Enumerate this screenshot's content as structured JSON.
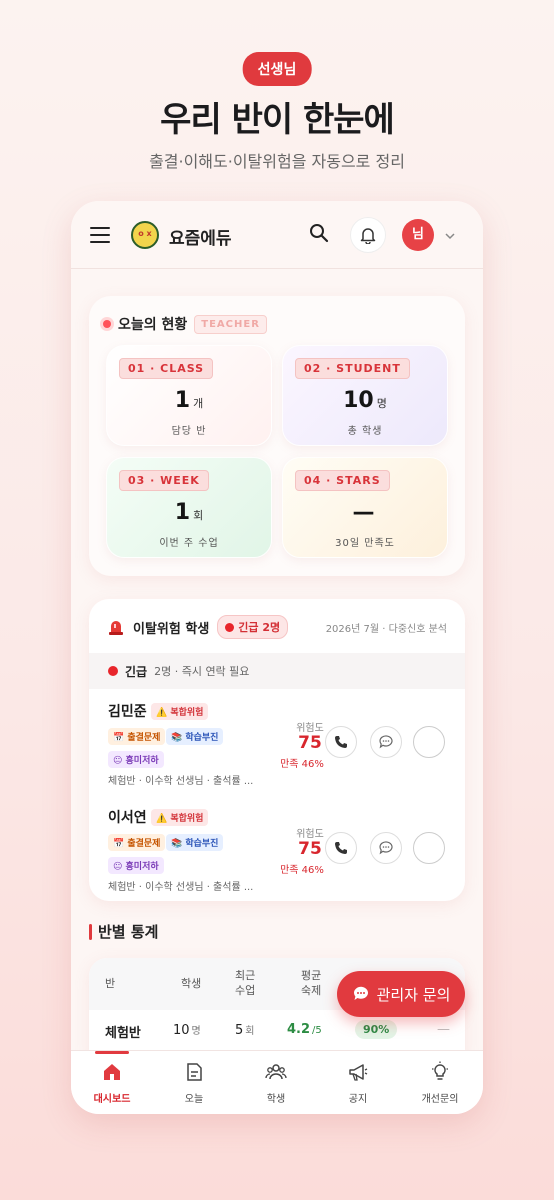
{
  "promo": {
    "pill": "선생님",
    "headline": "우리 반이 한눈에",
    "subline": "출결·이해도·이탈위험을 자동으로 정리"
  },
  "appbar": {
    "logo_text": "o x",
    "brand": "요즘에듀",
    "avatar": "님"
  },
  "today": {
    "title": "오늘의 현황",
    "tag": "TEACHER",
    "stats": [
      {
        "tag": "01 · CLASS",
        "value": "1",
        "unit": "개",
        "label": "담당 반"
      },
      {
        "tag": "02 · STUDENT",
        "value": "10",
        "unit": "명",
        "label": "총 학생"
      },
      {
        "tag": "03 · WEEK",
        "value": "1",
        "unit": "회",
        "label": "이번 주 수업"
      },
      {
        "tag": "04 · STARS",
        "value": "—",
        "unit": "",
        "label": "30일 만족도"
      }
    ]
  },
  "risk": {
    "title": "이탈위험 학생",
    "urgent_pill": "긴급 2명",
    "meta": "2026년 7월 · 다중신호 분석",
    "urgent_label": "긴급",
    "urgent_note": "2명 · 즉시 연락 필요",
    "students": [
      {
        "name": "김민준",
        "badge_complex": "⚠️ 복합위험",
        "badge_attendance": "📅 출결문제",
        "badge_study": "📚 학습부진",
        "badge_interest": "😐 흥미저하",
        "info": "체험반 · 이수학 선생님 · 출석률 ...",
        "risk_label": "위험도",
        "risk_value": "75",
        "satisfaction": "만족 46%"
      },
      {
        "name": "이서연",
        "badge_complex": "⚠️ 복합위험",
        "badge_attendance": "📅 출결문제",
        "badge_study": "📚 학습부진",
        "badge_interest": "😐 흥미저하",
        "info": "체험반 · 이수학 선생님 · 출석률 ...",
        "risk_label": "위험도",
        "risk_value": "75",
        "satisfaction": "만족 46%"
      }
    ]
  },
  "class_stats": {
    "title": "반별 통계",
    "headers": {
      "class": "반",
      "students": "학생",
      "recent_1": "최근",
      "recent_2": "수업",
      "avg_1": "평균",
      "avg_2": "숙제",
      "extra": "—"
    },
    "row": {
      "class": "체험반",
      "students": "10",
      "students_unit": "명",
      "recent": "5",
      "recent_unit": "회",
      "avg": "4.2",
      "avg_unit": "/5",
      "pct": "90%",
      "extra": "—"
    }
  },
  "fab": {
    "label": "관리자 문의"
  },
  "tabs": [
    {
      "label": "대시보드",
      "icon": "house-icon"
    },
    {
      "label": "오늘",
      "icon": "document-icon"
    },
    {
      "label": "학생",
      "icon": "people-icon"
    },
    {
      "label": "공지",
      "icon": "megaphone-icon"
    },
    {
      "label": "개선문의",
      "icon": "lightbulb-icon"
    }
  ],
  "colors": {
    "accent": "#e03a3e",
    "danger": "#d8262d",
    "success": "#2c8c43"
  }
}
